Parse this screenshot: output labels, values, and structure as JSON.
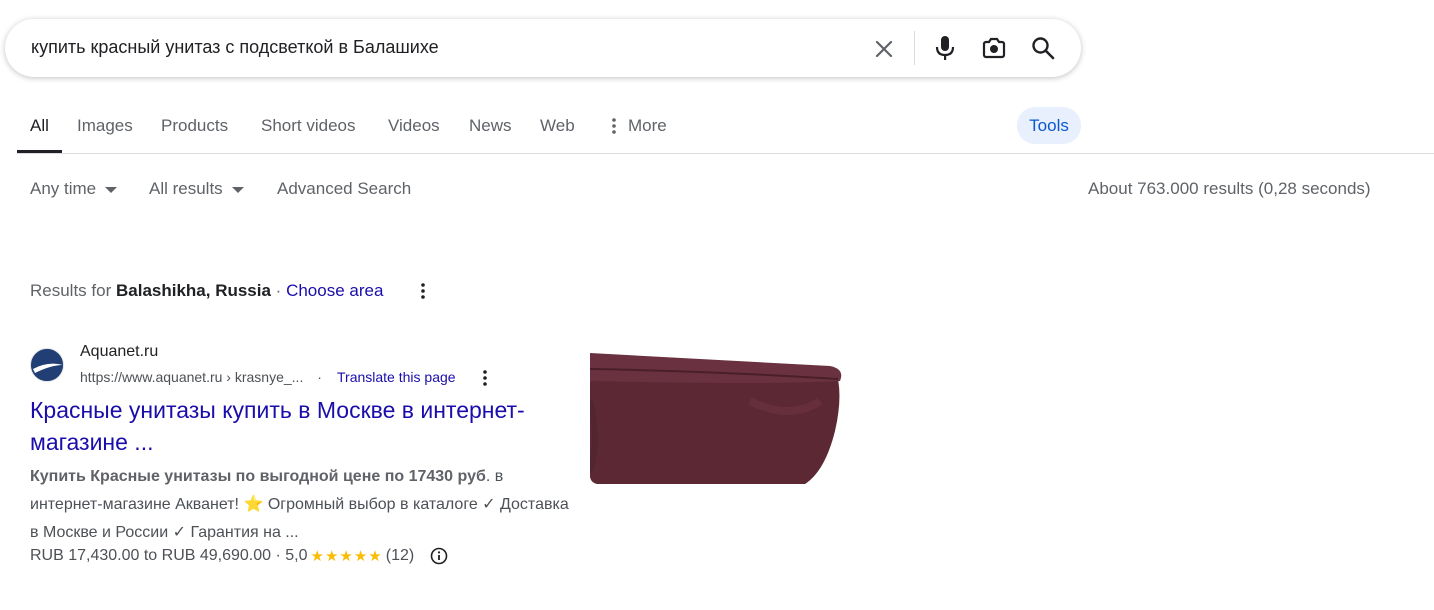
{
  "search": {
    "query": "купить красный унитаз с подсветкой в Балашихе"
  },
  "tabs": [
    {
      "label": "All",
      "active": true
    },
    {
      "label": "Images"
    },
    {
      "label": "Products"
    },
    {
      "label": "Short videos"
    },
    {
      "label": "Videos"
    },
    {
      "label": "News"
    },
    {
      "label": "Web"
    },
    {
      "label": "More"
    }
  ],
  "tools_label": "Tools",
  "filters": {
    "any_time": "Any time",
    "all_results": "All results",
    "advanced": "Advanced Search"
  },
  "stats": "About 763.000 results (0,28 seconds)",
  "location": {
    "prefix": "Results for",
    "place": "Balashikha, Russia",
    "separator": " · ",
    "choose": "Choose area"
  },
  "result": {
    "site_name": "Aquanet.ru",
    "url": "https://www.aquanet.ru › krasnye_...",
    "url_dot": "·",
    "translate": "Translate this page",
    "title": "Красные унитазы купить в Москве в интернет-магазине ...",
    "snippet_bold": "Купить Красные унитазы по выгодной цене по 17430 руб",
    "snippet_rest1": ". в интернет-магазине Акванет! ",
    "snippet_emoji": "⭐",
    "snippet_rest2": " Огромный выбор в каталоге ✓ Доставка в Москве и России ✓ Гарантия на ...",
    "price_range": "RUB 17,430.00 to RUB 49,690.00",
    "rating_sep": " · ",
    "rating": "5,0",
    "stars": "★★★★★",
    "rating_value": 5.0,
    "reviews": "(12)"
  },
  "colors": {
    "link": "#1a0dab",
    "accent_blue": "#0b57d0",
    "tools_bg": "#e8f0fe",
    "star": "#fbbc04",
    "toilet": "#5e2a35"
  },
  "icons": [
    "clear-icon",
    "microphone-icon",
    "lens-icon",
    "search-icon",
    "more-dots-icon",
    "info-icon"
  ]
}
